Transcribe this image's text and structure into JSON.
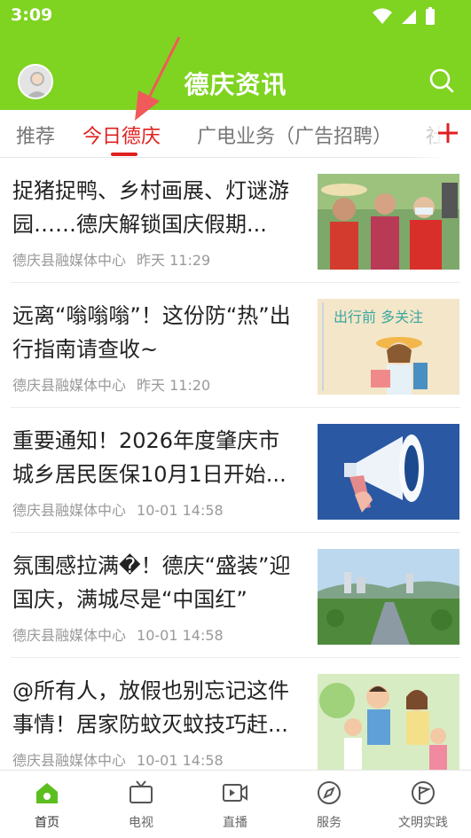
{
  "status_bar": {
    "time": "3:09"
  },
  "header": {
    "title": "德庆资讯"
  },
  "tabs": [
    {
      "label": "推荐"
    },
    {
      "label": "今日德庆"
    },
    {
      "label": "广电业务（广告招聘）"
    },
    {
      "label": "社"
    }
  ],
  "news": [
    {
      "title": "捉猪捉鸭、乡村画展、灯谜游园……德庆解锁国庆假期...",
      "source": "德庆县融媒体中心",
      "time": "昨天 11:29"
    },
    {
      "title": "远离“嗡嗡嗡”！这份防“热”出行指南请查收~",
      "source": "德庆县融媒体中心",
      "time": "昨天 11:20",
      "image_text": "出行前 多关注"
    },
    {
      "title": "重要通知！2026年度肇庆市城乡居民医保10月1日开始...",
      "source": "德庆县融媒体中心",
      "time": "10-01 14:58"
    },
    {
      "title": "氛围感拉满�！德庆“盛装”迎国庆，满城尽是“中国红”",
      "source": "德庆县融媒体中心",
      "time": "10-01 14:58"
    },
    {
      "title": "@所有人，放假也别忘记这件事情！居家防蚊灭蚊技巧赶...",
      "source": "德庆县融媒体中心",
      "time": "10-01 14:58"
    }
  ],
  "bottom_nav": [
    {
      "label": "首页",
      "icon": "home-icon"
    },
    {
      "label": "电视",
      "icon": "tv-icon"
    },
    {
      "label": "直播",
      "icon": "live-video-icon"
    },
    {
      "label": "服务",
      "icon": "compass-icon"
    },
    {
      "label": "文明实践",
      "icon": "flag-circle-icon"
    }
  ],
  "colors": {
    "brand_green": "#7fd321",
    "active_red": "#e02020",
    "nav_active_green": "#5cbf1f"
  }
}
